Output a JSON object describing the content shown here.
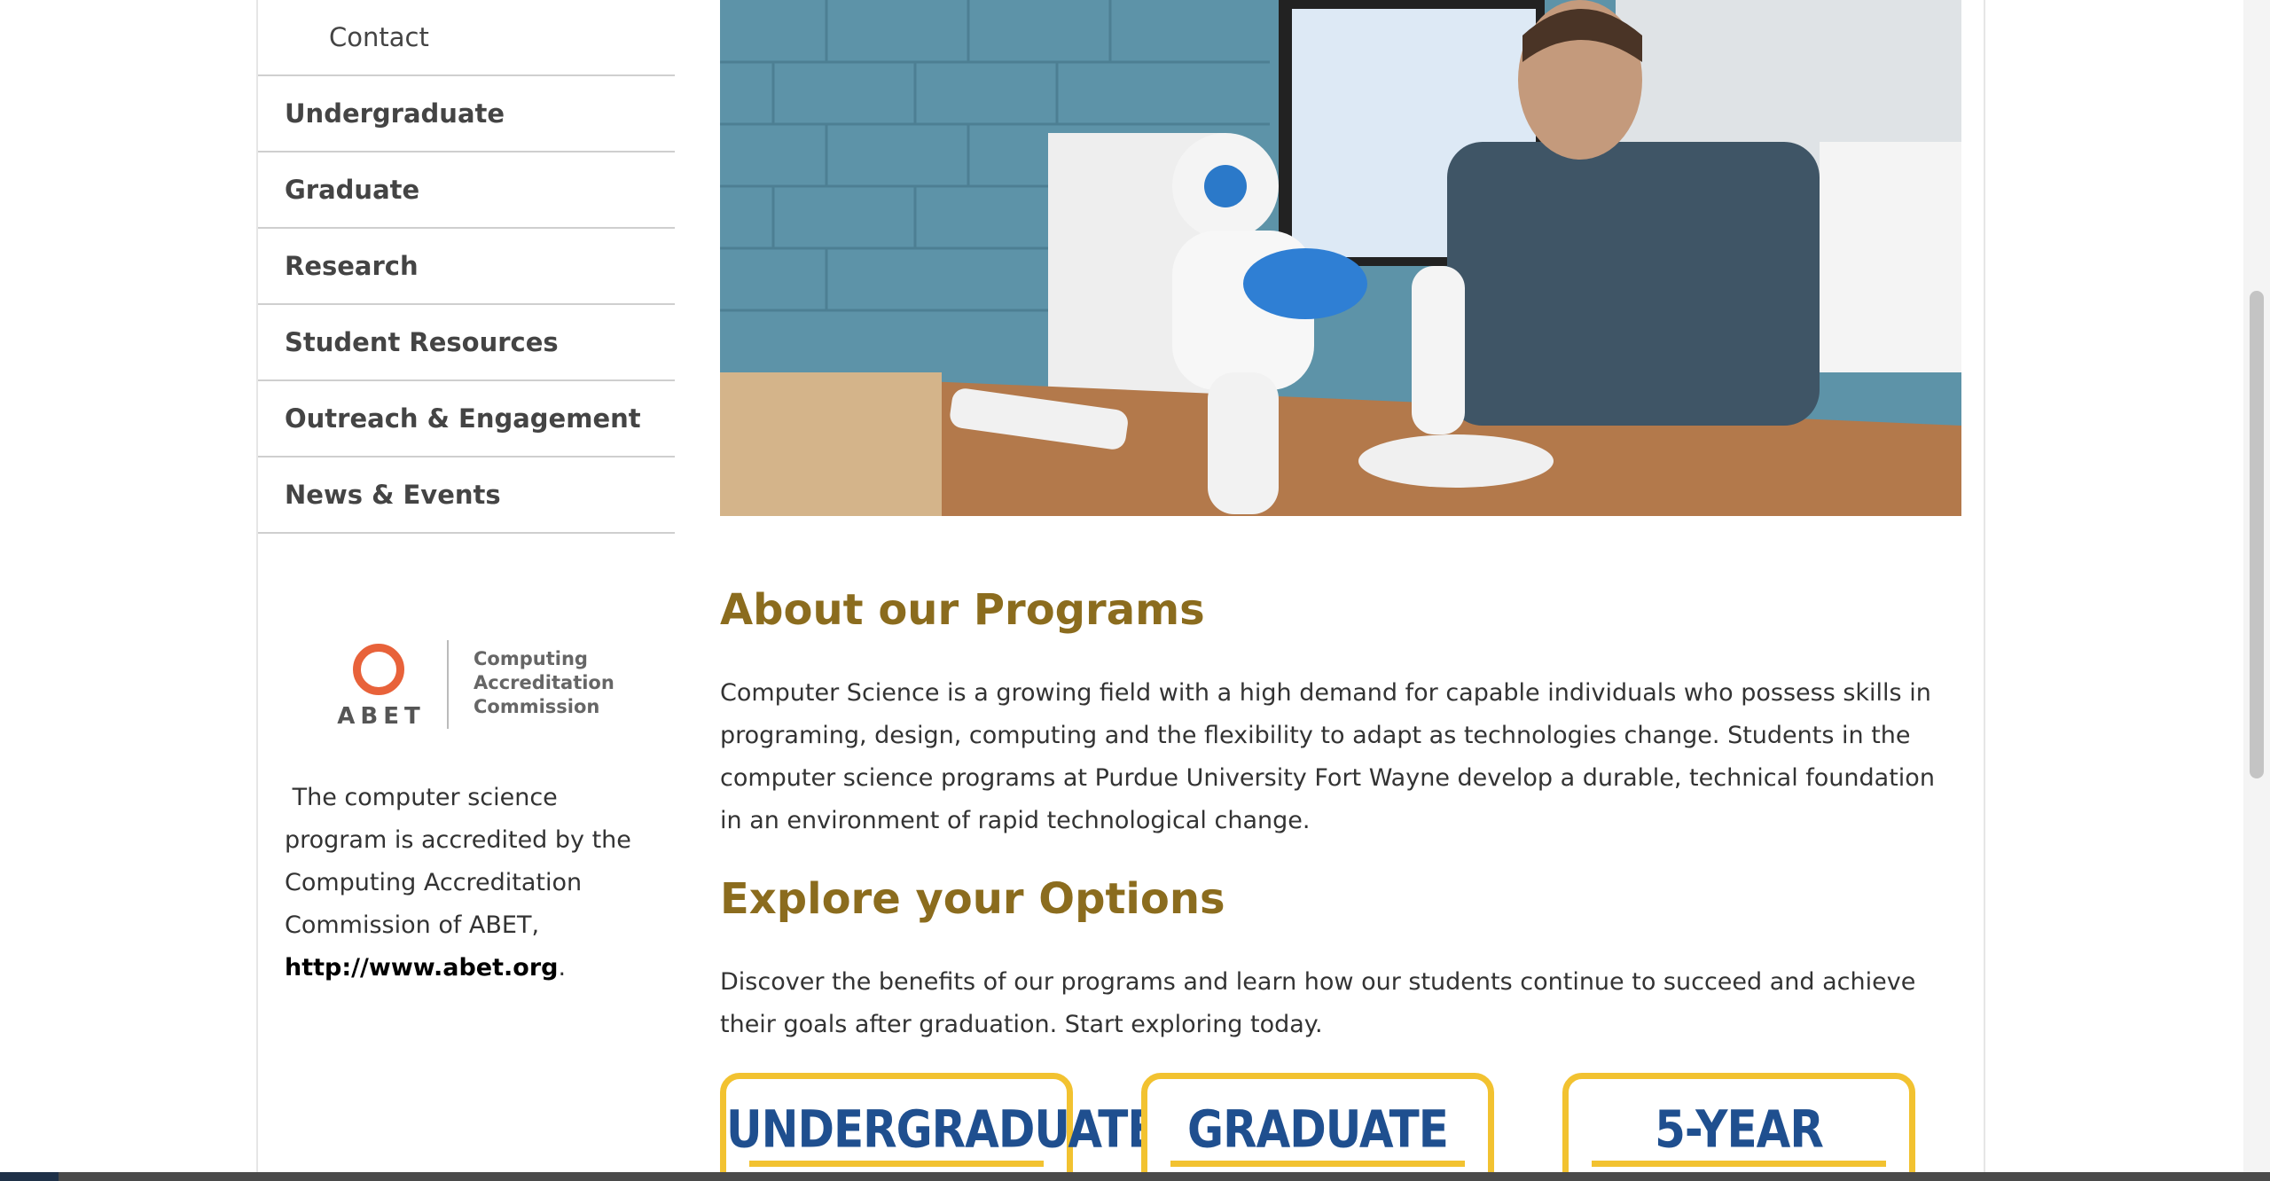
{
  "sidebar": {
    "items": [
      {
        "label": "Contact",
        "sub": true
      },
      {
        "label": "Undergraduate"
      },
      {
        "label": "Graduate"
      },
      {
        "label": "Research"
      },
      {
        "label": "Student Resources"
      },
      {
        "label": "Outreach & Engagement"
      },
      {
        "label": "News & Events"
      }
    ],
    "abet": {
      "word": "ABET",
      "line1": "Computing",
      "line2": "Accreditation",
      "line3": "Commission"
    },
    "accreditation_text": "The computer science program is accredited by the Computing Accreditation Commission of ABET,",
    "accreditation_link": "http://www.abet.org",
    "accreditation_end": "."
  },
  "main": {
    "about_heading": "About our Programs",
    "about_text": "Computer Science is a growing field with a high demand for capable individuals who possess skills in programing, design, computing and the flexibility to adapt as technologies change. Students in the computer science programs at Purdue University Fort Wayne develop a durable, technical foundation in an environment of rapid technological change.",
    "explore_heading": "Explore your Options",
    "explore_text": "Discover the benefits of our programs and learn how our students continue to succeed and achieve their goals after graduation. Start exploring today.",
    "program_buttons": [
      "UNDERGRADUATE",
      "GRADUATE",
      "5-YEAR"
    ]
  },
  "colors": {
    "heading_gold": "#8b6c1e",
    "button_border": "#f2c230",
    "button_text": "#1f4f8f",
    "abet_orange": "#e8623a"
  }
}
